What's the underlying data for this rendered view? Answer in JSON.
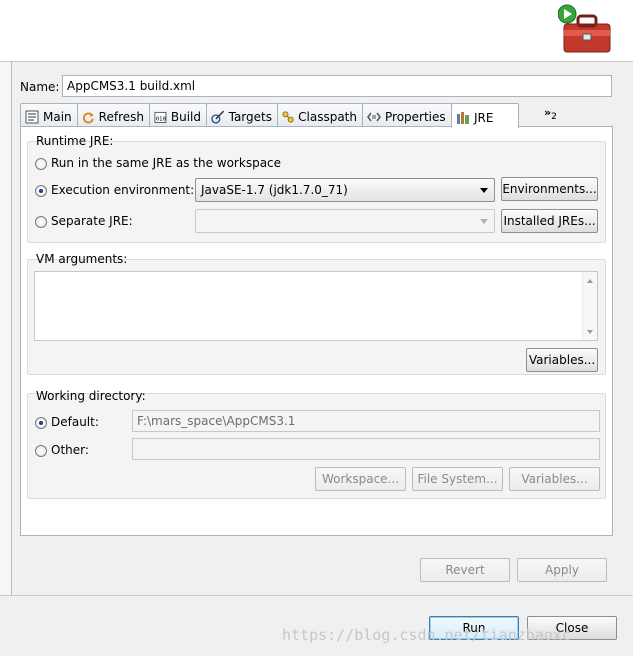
{
  "name": {
    "label": "Name:",
    "value": "AppCMS3.1 build.xml"
  },
  "tabs": [
    {
      "label": "Main",
      "icon": "main-tab-icon"
    },
    {
      "label": "Refresh",
      "icon": "refresh-icon"
    },
    {
      "label": "Build",
      "icon": "build-icon"
    },
    {
      "label": "Targets",
      "icon": "targets-icon"
    },
    {
      "label": "Classpath",
      "icon": "classpath-icon"
    },
    {
      "label": "Properties",
      "icon": "properties-icon"
    },
    {
      "label": "JRE",
      "icon": "jre-icon"
    }
  ],
  "tab_overflow": {
    "chevron": "»",
    "count": "2"
  },
  "runtime_jre": {
    "title": "Runtime JRE:",
    "options": {
      "same": "Run in the same JRE as the workspace",
      "execution": "Execution environment:",
      "separate": "Separate JRE:"
    },
    "execution_value": "JavaSE-1.7 (jdk1.7.0_71)",
    "environments_button": "Environments...",
    "installed_button": "Installed JREs..."
  },
  "vm_arguments": {
    "title": "VM arguments:",
    "value": "",
    "variables_button": "Variables..."
  },
  "working_directory": {
    "title": "Working directory:",
    "default_label": "Default:",
    "default_value": "F:\\mars_space\\AppCMS3.1",
    "other_label": "Other:",
    "other_value": "",
    "workspace_button": "Workspace...",
    "filesystem_button": "File System...",
    "variables_button": "Variables..."
  },
  "footer": {
    "revert": "Revert",
    "apply": "Apply",
    "run": "Run",
    "close": "Close"
  },
  "watermark": "https://blog.csdn.net/tianzhaoxc",
  "colors": {
    "accent": "#3c7fb1",
    "panel": "#ffffff",
    "background": "#f0f0f0"
  }
}
